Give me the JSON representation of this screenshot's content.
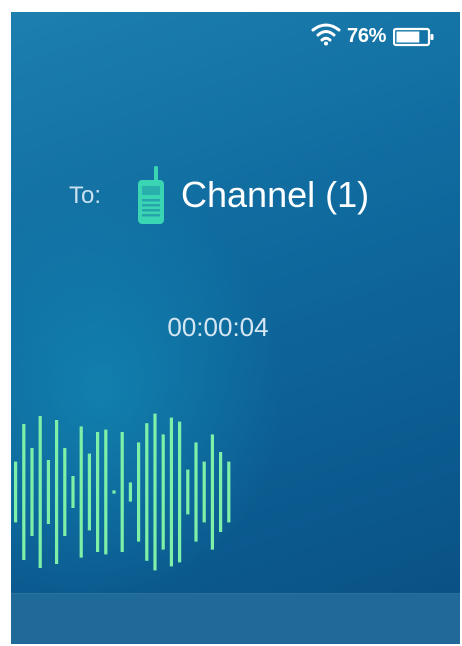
{
  "status_bar": {
    "wifi_icon": "wifi-icon",
    "battery_percent": "76%",
    "battery_level": 0.76,
    "battery_icon": "battery-icon"
  },
  "call": {
    "to_label": "To:",
    "channel_icon": "walkie-talkie-icon",
    "channel_name": "Channel (1)",
    "elapsed_time": "00:00:04"
  },
  "waveform": {
    "color": "#7ef0a8",
    "bar_heights": [
      0.38,
      0.85,
      0.55,
      0.95,
      0.4,
      0.9,
      0.55,
      0.2,
      0.82,
      0.48,
      0.75,
      0.78,
      0.02,
      0.75,
      0.12,
      0.62,
      0.86,
      0.98,
      0.72,
      0.93,
      0.88,
      0.28,
      0.62,
      0.38,
      0.72,
      0.5,
      0.38
    ]
  },
  "colors": {
    "accent_teal": "#3ad6b4",
    "waveform_green": "#7ef0a8",
    "background_blue": "#0f6a9e"
  }
}
